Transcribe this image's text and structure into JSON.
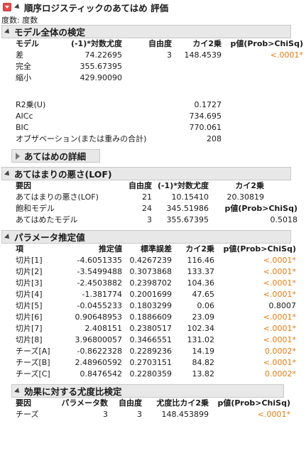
{
  "title": "順序ロジスティックのあてはめ 評価",
  "freq_label": "度数: 度数",
  "whole_model": {
    "title": "モデル全体の検定",
    "headers": [
      "モデル",
      "(-1)*対数尤度",
      "自由度",
      "カイ2乗",
      "p値(Prob>ChiSq)"
    ],
    "rows": [
      [
        "差",
        "74.22695",
        "3",
        "148.4539",
        "<.0001*"
      ],
      [
        "完全",
        "355.67395",
        "",
        "",
        ""
      ],
      [
        "縮小",
        "429.90090",
        "",
        "",
        ""
      ]
    ],
    "stats": [
      [
        "R2乗(U)",
        "0.1727"
      ],
      [
        "AICc",
        "734.695"
      ],
      [
        "BIC",
        "770.061"
      ],
      [
        "オブザベーション(または重みの合計)",
        "208"
      ]
    ]
  },
  "fit_details": {
    "title": "あてはめの詳細"
  },
  "lof": {
    "title": "あてはまりの悪さ(LOF)",
    "headers": [
      "要因",
      "自由度",
      "(-1)*対数尤度",
      "カイ2乗"
    ],
    "rows": [
      [
        "あてはまりの悪さ(LOF)",
        "21",
        "10.15410",
        "20.30819"
      ],
      [
        "飽和モデル",
        "24",
        "345.51986",
        "p値(Prob>ChiSq)"
      ],
      [
        "あてはめたモデル",
        "3",
        "355.67395",
        "0.5018"
      ]
    ]
  },
  "params": {
    "title": "パラメータ推定値",
    "headers": [
      "項",
      "推定値",
      "標準誤差",
      "カイ2乗",
      "p値(Prob>ChiSq)"
    ],
    "rows": [
      [
        "切片[1]",
        "-4.6051335",
        "0.4267239",
        "116.46",
        "<.0001*"
      ],
      [
        "切片[2]",
        "-3.5499488",
        "0.3073868",
        "133.37",
        "<.0001*"
      ],
      [
        "切片[3]",
        "-2.4503882",
        "0.2398702",
        "104.36",
        "<.0001*"
      ],
      [
        "切片[4]",
        "-1.381774",
        "0.2001699",
        "47.65",
        "<.0001*"
      ],
      [
        "切片[5]",
        "-0.0455233",
        "0.1803299",
        "0.06",
        "0.8007"
      ],
      [
        "切片[6]",
        "0.90648953",
        "0.1886609",
        "23.09",
        "<.0001*"
      ],
      [
        "切片[7]",
        "2.408151",
        "0.2380517",
        "102.34",
        "<.0001*"
      ],
      [
        "切片[8]",
        "3.96800057",
        "0.3466551",
        "131.02",
        "<.0001*"
      ],
      [
        "チーズ[A]",
        "-0.8622328",
        "0.2289236",
        "14.19",
        "0.0002*"
      ],
      [
        "チーズ[B]",
        "2.48960592",
        "0.2703151",
        "84.82",
        "<.0001*"
      ],
      [
        "チーズ[C]",
        "0.8476542",
        "0.2280359",
        "13.82",
        "0.0002*"
      ]
    ]
  },
  "effect_lr": {
    "title": "効果に対する尤度比検定",
    "headers": [
      "要因",
      "パラメータ数",
      "自由度",
      "尤度比カイ2乗",
      "p値(Prob>ChiSq)"
    ],
    "rows": [
      [
        "チーズ",
        "3",
        "3",
        "148.453899",
        "<.0001*"
      ]
    ]
  },
  "colors": {
    "significant": "#e07b12",
    "outline_bg": "#e8e8e8"
  }
}
